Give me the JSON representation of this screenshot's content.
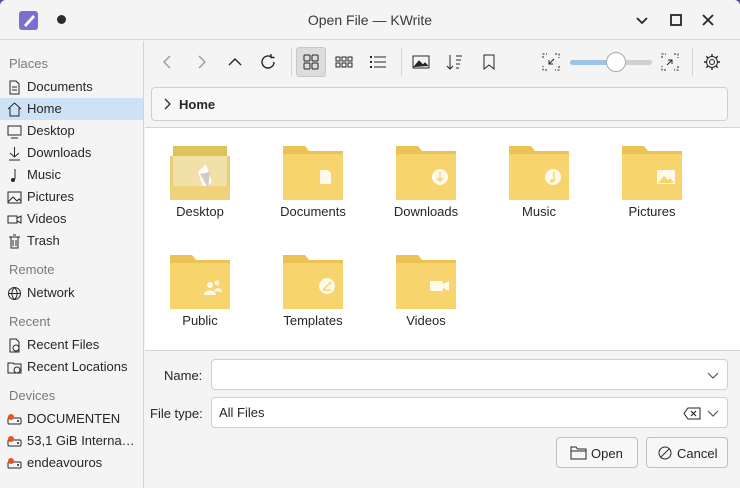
{
  "window": {
    "title": "Open File — KWrite"
  },
  "sidebar": {
    "sections": [
      {
        "title": "Places",
        "items": [
          {
            "label": "Documents",
            "icon": "document-icon"
          },
          {
            "label": "Home",
            "icon": "home-icon",
            "active": true
          },
          {
            "label": "Desktop",
            "icon": "desktop-icon"
          },
          {
            "label": "Downloads",
            "icon": "download-icon"
          },
          {
            "label": "Music",
            "icon": "music-icon"
          },
          {
            "label": "Pictures",
            "icon": "picture-icon"
          },
          {
            "label": "Videos",
            "icon": "video-icon"
          },
          {
            "label": "Trash",
            "icon": "trash-icon"
          }
        ]
      },
      {
        "title": "Remote",
        "items": [
          {
            "label": "Network",
            "icon": "network-icon"
          }
        ]
      },
      {
        "title": "Recent",
        "items": [
          {
            "label": "Recent Files",
            "icon": "recent-files-icon"
          },
          {
            "label": "Recent Locations",
            "icon": "recent-locations-icon"
          }
        ]
      },
      {
        "title": "Devices",
        "items": [
          {
            "label": "DOCUMENTEN",
            "icon": "drive-icon"
          },
          {
            "label": "53,1 GiB Interna…",
            "icon": "drive-icon"
          },
          {
            "label": "endeavouros",
            "icon": "drive-icon"
          }
        ]
      }
    ]
  },
  "breadcrumb": {
    "current": "Home"
  },
  "zoom": {
    "level": 0.55
  },
  "files": [
    {
      "label": "Desktop",
      "emblem": "desktop"
    },
    {
      "label": "Documents",
      "emblem": "document"
    },
    {
      "label": "Downloads",
      "emblem": "download"
    },
    {
      "label": "Music",
      "emblem": "music"
    },
    {
      "label": "Pictures",
      "emblem": "picture"
    },
    {
      "label": "Public",
      "emblem": "public"
    },
    {
      "label": "Templates",
      "emblem": "template"
    },
    {
      "label": "Videos",
      "emblem": "video"
    }
  ],
  "form": {
    "name_label": "Name:",
    "name_value": "",
    "filetype_label": "File type:",
    "filetype_value": "All Files"
  },
  "buttons": {
    "open": "Open",
    "cancel": "Cancel"
  },
  "colors": {
    "accent": "#cde3f5",
    "folder": "#f7d46e",
    "folder_tab": "#edc254"
  }
}
